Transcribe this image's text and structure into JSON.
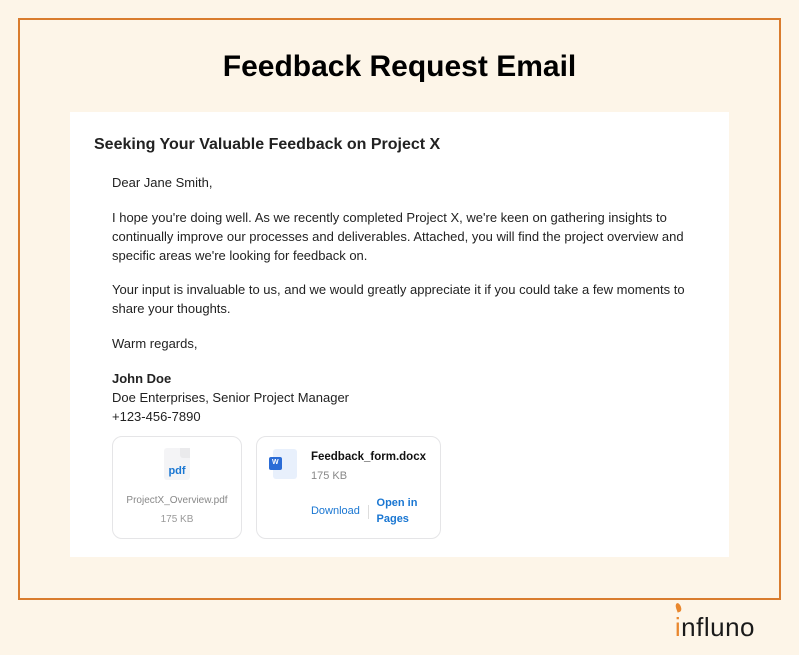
{
  "page_title": "Feedback Request Email",
  "email": {
    "subject": "Seeking Your Valuable Feedback on Project X",
    "greeting": "Dear Jane Smith,",
    "paragraph1": "I hope you're doing well. As we recently completed Project X, we're keen on gathering insights to continually improve our processes and deliverables. Attached, you will find the project overview and specific areas we're looking for feedback on.",
    "paragraph2": "Your input is invaluable to us, and we would greatly appreciate it if you could take a few moments to share your thoughts.",
    "closing": "Warm regards,",
    "signature": {
      "name": "John Doe",
      "company_role": "Doe Enterprises, Senior Project Manager",
      "phone": "+123-456-7890"
    }
  },
  "attachments": {
    "pdf": {
      "badge": "pdf",
      "filename": "ProjectX_Overview.pdf",
      "size": "175 KB"
    },
    "docx": {
      "badge": "W",
      "filename": "Feedback_form.docx",
      "size": "175 KB",
      "download_label": "Download",
      "open_label": "Open in Pages"
    }
  },
  "brand": "influno"
}
